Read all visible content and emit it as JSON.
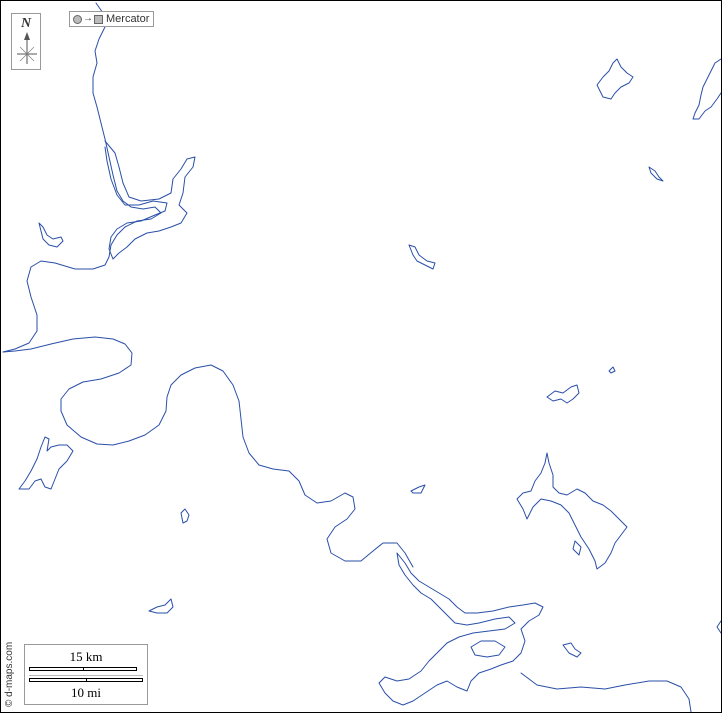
{
  "map": {
    "compass_label": "N",
    "projection_label": "Mercator",
    "credit": "© d-maps.com",
    "scale": {
      "km_label": "15 km",
      "mi_label": "10 mi"
    },
    "water_color": "#2a4fa8",
    "icons": {
      "compass": "compass-rose-icon",
      "projection": "globe-to-flat-icon"
    }
  }
}
